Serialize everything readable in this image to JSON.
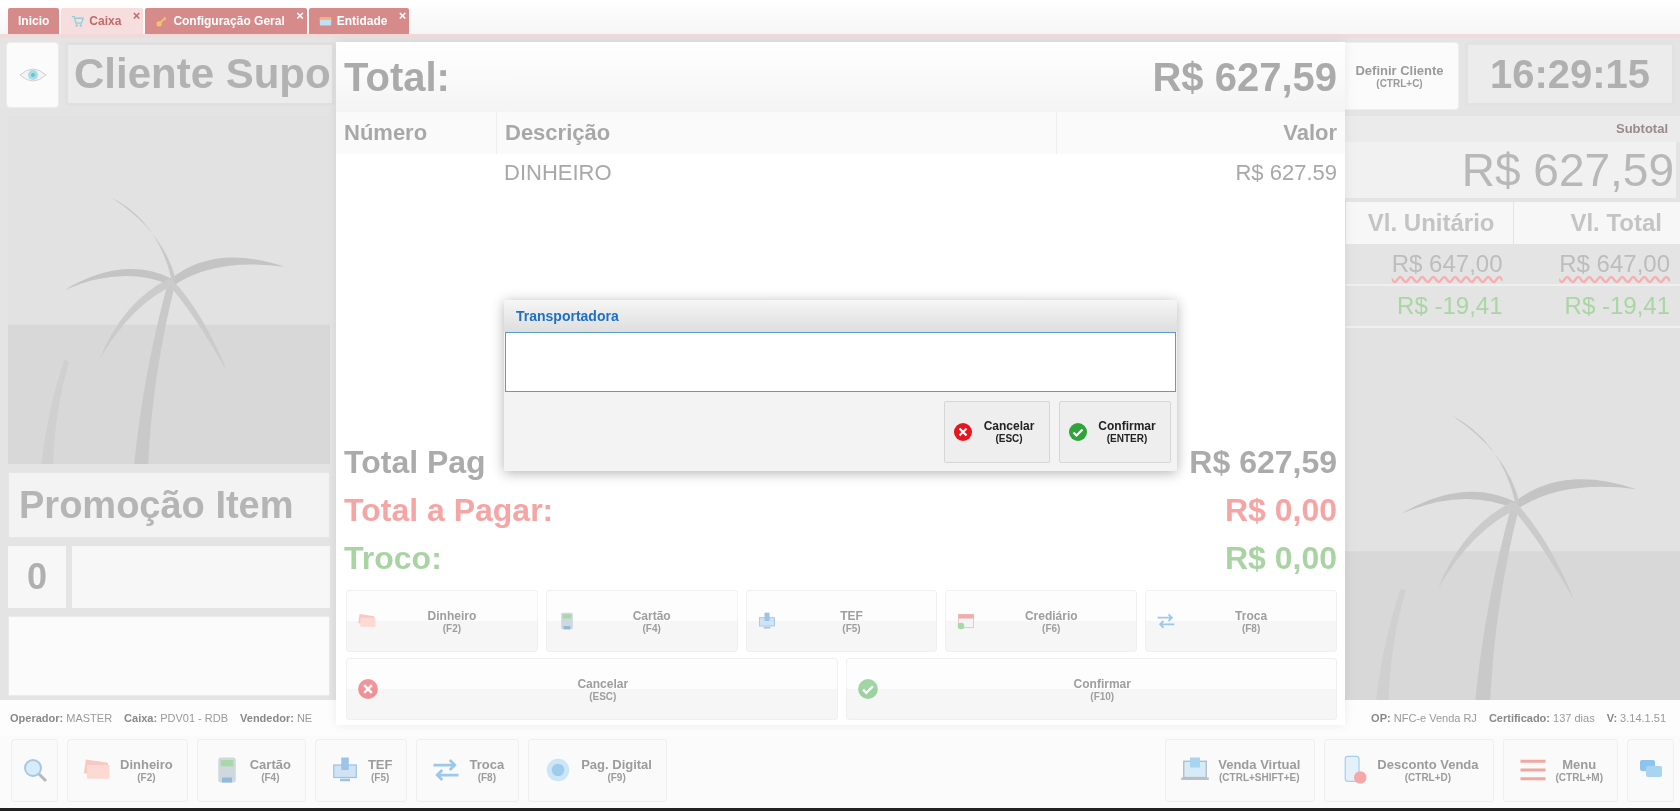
{
  "tabs": [
    {
      "label": "Inicio",
      "selected": false,
      "closable": false
    },
    {
      "label": "Caixa",
      "selected": true,
      "closable": true
    },
    {
      "label": "Configuração Geral",
      "selected": false,
      "closable": true
    },
    {
      "label": "Entidade",
      "selected": false,
      "closable": true
    }
  ],
  "close_glyph": "×",
  "header": {
    "customer": "Cliente Supo",
    "define_client": {
      "label": "Definir Cliente",
      "shortcut": "(CTRL+C)"
    },
    "clock": "16:29:15"
  },
  "subtotal": {
    "label": "Subtotal",
    "value": "R$ 627,59"
  },
  "items": {
    "columns": [
      "Vl. Unitário",
      "Vl. Total"
    ],
    "rows": [
      {
        "kind": "item",
        "unit": "R$ 647,00",
        "total": "R$ 647,00"
      },
      {
        "kind": "discount",
        "unit": "R$ -19,41",
        "total": "R$ -19,41"
      }
    ]
  },
  "promotion": "Promoção Item",
  "quantity": "0",
  "status_left": [
    {
      "label": "Operador:",
      "value": "MASTER"
    },
    {
      "label": "Caixa:",
      "value": "PDV01 - RDB"
    },
    {
      "label": "Vendedor:",
      "value": "NE"
    }
  ],
  "status_right": [
    {
      "label": "OP:",
      "value": "NFC-e Venda RJ"
    },
    {
      "label": "Certificado:",
      "value": "137 dias"
    },
    {
      "label": "V:",
      "value": "3.14.1.51"
    }
  ],
  "toolbar_left": [
    {
      "label": "Dinheiro",
      "shortcut": "(F2)"
    },
    {
      "label": "Cartão",
      "shortcut": "(F4)"
    },
    {
      "label": "TEF",
      "shortcut": "(F5)"
    },
    {
      "label": "Troca",
      "shortcut": "(F8)"
    },
    {
      "label": "Pag. Digital",
      "shortcut": "(F9)"
    }
  ],
  "toolbar_right": [
    {
      "label": "Venda Virtual",
      "shortcut": "(CTRL+SHIFT+E)"
    },
    {
      "label": "Desconto Venda",
      "shortcut": "(CTRL+D)"
    },
    {
      "label": "Menu",
      "shortcut": "(CTRL+M)"
    }
  ],
  "payment": {
    "title": "Total:",
    "amount": "R$ 627,59",
    "columns": [
      "Número",
      "Descrição",
      "Valor"
    ],
    "rows": [
      {
        "description": "DINHEIRO",
        "value": "R$ 627.59"
      }
    ],
    "summary": [
      {
        "kind": "paid",
        "label": "Total Pag",
        "value": "R$ 627,59"
      },
      {
        "kind": "due",
        "label": "Total a Pagar:",
        "value": "R$ 0,00"
      },
      {
        "kind": "change",
        "label": "Troco:",
        "value": "R$ 0,00"
      }
    ],
    "methods": [
      {
        "label": "Dinheiro",
        "shortcut": "(F2)"
      },
      {
        "label": "Cartão",
        "shortcut": "(F4)"
      },
      {
        "label": "TEF",
        "shortcut": "(F5)"
      },
      {
        "label": "Crediário",
        "shortcut": "(F6)"
      },
      {
        "label": "Troca",
        "shortcut": "(F8)"
      }
    ],
    "actions": [
      {
        "kind": "cancel",
        "label": "Cancelar",
        "shortcut": "(ESC)"
      },
      {
        "kind": "confirm",
        "label": "Confirmar",
        "shortcut": "(F10)"
      }
    ]
  },
  "dialog": {
    "title": "Transportadora",
    "buttons": [
      {
        "kind": "cancel",
        "label": "Cancelar",
        "shortcut": "(ESC)"
      },
      {
        "kind": "confirm",
        "label": "Confirmar",
        "shortcut": "(ENTER)"
      }
    ]
  }
}
